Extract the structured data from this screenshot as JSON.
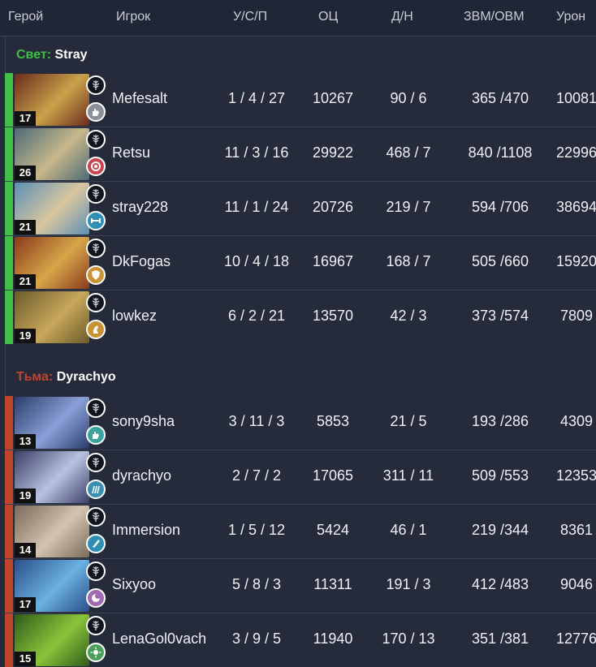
{
  "columns": {
    "hero": "Герой",
    "player": "Игрок",
    "kda": "У/С/П",
    "nw": "ОЦ",
    "lh_dn": "Д/Н",
    "gpm_xpm": "ЗВМ/ОВМ",
    "damage": "Урон"
  },
  "colors": {
    "radiant": "#3fbf48",
    "dire": "#c0432e",
    "background": "#252b3b"
  },
  "radiant": {
    "side_label": "Свет:",
    "team_name": "Stray",
    "players": [
      {
        "level": "17",
        "name": "Mefesalt",
        "kda": "1 / 4 / 27",
        "nw": "10267",
        "lh_dn": "90 / 6",
        "gpm_xpm": "365 /470",
        "damage": "10081",
        "role_icon": "support-hand-icon",
        "role_color": "#8a8f99"
      },
      {
        "level": "26",
        "name": "Retsu",
        "kda": "11 / 3 / 16",
        "nw": "29922",
        "lh_dn": "468 / 7",
        "gpm_xpm": "840 /1108",
        "damage": "22996",
        "role_icon": "carry-swirl-icon",
        "role_color": "#c8444f"
      },
      {
        "level": "21",
        "name": "stray228",
        "kda": "11 / 1 / 24",
        "nw": "20726",
        "lh_dn": "219 / 7",
        "gpm_xpm": "594 /706",
        "damage": "38694",
        "role_icon": "mid-dumbbell-icon",
        "role_color": "#2e8fb3"
      },
      {
        "level": "21",
        "name": "DkFogas",
        "kda": "10 / 4 / 18",
        "nw": "16967",
        "lh_dn": "168 / 7",
        "gpm_xpm": "505 /660",
        "damage": "15920",
        "role_icon": "offlane-shield-icon",
        "role_color": "#c99232"
      },
      {
        "level": "19",
        "name": "lowkez",
        "kda": "6 / 2 / 21",
        "nw": "13570",
        "lh_dn": "42 / 3",
        "gpm_xpm": "373 /574",
        "damage": "7809",
        "role_icon": "support-knight-icon",
        "role_color": "#c99232"
      }
    ]
  },
  "dire": {
    "side_label": "Тьма:",
    "team_name": "Dyrachyo",
    "players": [
      {
        "level": "13",
        "name": "sony9sha",
        "kda": "3 / 11 / 3",
        "nw": "5853",
        "lh_dn": "21 / 5",
        "gpm_xpm": "193 /286",
        "damage": "4309",
        "role_icon": "support-hand-icon",
        "role_color": "#3aa3a0"
      },
      {
        "level": "19",
        "name": "dyrachyo",
        "kda": "2 / 7 / 2",
        "nw": "17065",
        "lh_dn": "311 / 11",
        "gpm_xpm": "509 /553",
        "damage": "12353",
        "role_icon": "carry-claw-icon",
        "role_color": "#3a8fb0"
      },
      {
        "level": "14",
        "name": "Immersion",
        "kda": "1 / 5 / 12",
        "nw": "5424",
        "lh_dn": "46 / 1",
        "gpm_xpm": "219 /344",
        "damage": "8361",
        "role_icon": "offlane-blade-icon",
        "role_color": "#2e8fb3"
      },
      {
        "level": "17",
        "name": "Sixyoo",
        "kda": "5 / 8 / 3",
        "nw": "11311",
        "lh_dn": "191 / 3",
        "gpm_xpm": "412 /483",
        "damage": "9046",
        "role_icon": "mid-orb-icon",
        "role_color": "#a06bb0"
      },
      {
        "level": "15",
        "name": "LenaGol0vach",
        "kda": "3 / 9 / 5",
        "nw": "11940",
        "lh_dn": "170 / 13",
        "gpm_xpm": "351 /381",
        "damage": "12776",
        "role_icon": "support-sun-icon",
        "role_color": "#4aa05b"
      }
    ]
  }
}
